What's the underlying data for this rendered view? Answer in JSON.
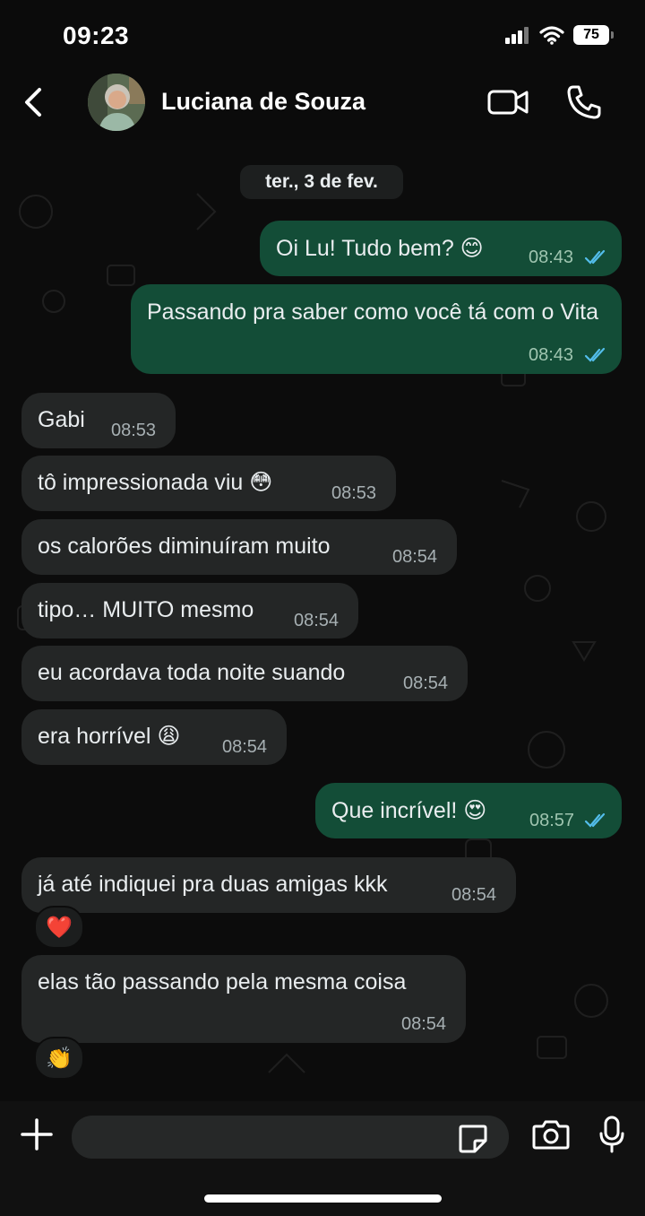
{
  "status_bar": {
    "time": "09:23",
    "battery": "75"
  },
  "header": {
    "contact_name": "Luciana de Souza",
    "icons": [
      "back-icon",
      "video-call-icon",
      "voice-call-icon"
    ]
  },
  "chat": {
    "date_label": "ter., 3 de fev.",
    "messages": [
      {
        "direction": "out",
        "text": "Oi Lu! Tudo bem? 😊",
        "time": "08:43",
        "status": "read"
      },
      {
        "direction": "out",
        "text": "Passando pra saber como você tá com o Vita",
        "time": "08:43",
        "status": "read"
      },
      {
        "direction": "in",
        "text": "Gabi",
        "time": "08:53"
      },
      {
        "direction": "in",
        "text": "tô impressionada viu 😳",
        "time": "08:53"
      },
      {
        "direction": "in",
        "text": "os calorões diminuíram muito",
        "time": "08:54"
      },
      {
        "direction": "in",
        "text": "tipo… MUITO mesmo",
        "time": "08:54"
      },
      {
        "direction": "in",
        "text": "eu acordava toda noite suando",
        "time": "08:54"
      },
      {
        "direction": "in",
        "text": "era horrível 😩",
        "time": "08:54"
      },
      {
        "direction": "out",
        "text": "Que incrível! 😍",
        "time": "08:57",
        "status": "read"
      },
      {
        "direction": "in",
        "text": "já até indiquei pra duas amigas kkk",
        "time": "08:54",
        "reaction": "❤️"
      },
      {
        "direction": "in",
        "text": "elas tão passando pela mesma coisa",
        "time": "08:54",
        "reaction": "👏"
      }
    ]
  },
  "composer": {
    "placeholder": "",
    "icons": [
      "plus-icon",
      "sticker-icon",
      "camera-icon",
      "mic-icon"
    ]
  },
  "colors": {
    "outgoing_bubble": "#134d37",
    "incoming_bubble": "#242626",
    "read_ticks": "#53bdeb",
    "background": "#0b0b0b"
  }
}
